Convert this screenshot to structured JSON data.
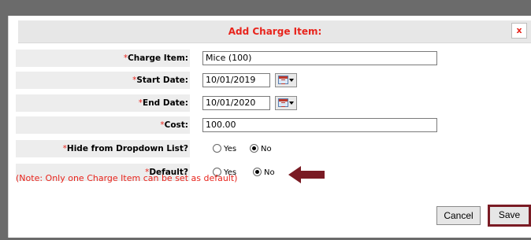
{
  "dialog": {
    "title": "Add Charge Item:",
    "close_label": "x"
  },
  "form": {
    "required_mark": "*",
    "charge_item": {
      "label": "Charge Item:",
      "value": "Mice (100)"
    },
    "start_date": {
      "label": "Start Date:",
      "value": "10/01/2019"
    },
    "end_date": {
      "label": "End Date:",
      "value": "10/01/2020"
    },
    "cost": {
      "label": "Cost:",
      "value": "100.00"
    },
    "hide_from_dropdown": {
      "label": "Hide from Dropdown List?",
      "yes": "Yes",
      "no": "No",
      "selected": "No"
    },
    "default": {
      "label": "Default?",
      "yes": "Yes",
      "no": "No",
      "selected": "No"
    },
    "note": "(Note: Only one Charge Item can be set as default)"
  },
  "buttons": {
    "cancel": "Cancel",
    "save": "Save"
  },
  "colors": {
    "accent_red": "#e8241c",
    "highlight": "#7a1b24"
  },
  "icons": {
    "calendar": "calendar-icon",
    "arrow": "left-arrow-icon"
  }
}
